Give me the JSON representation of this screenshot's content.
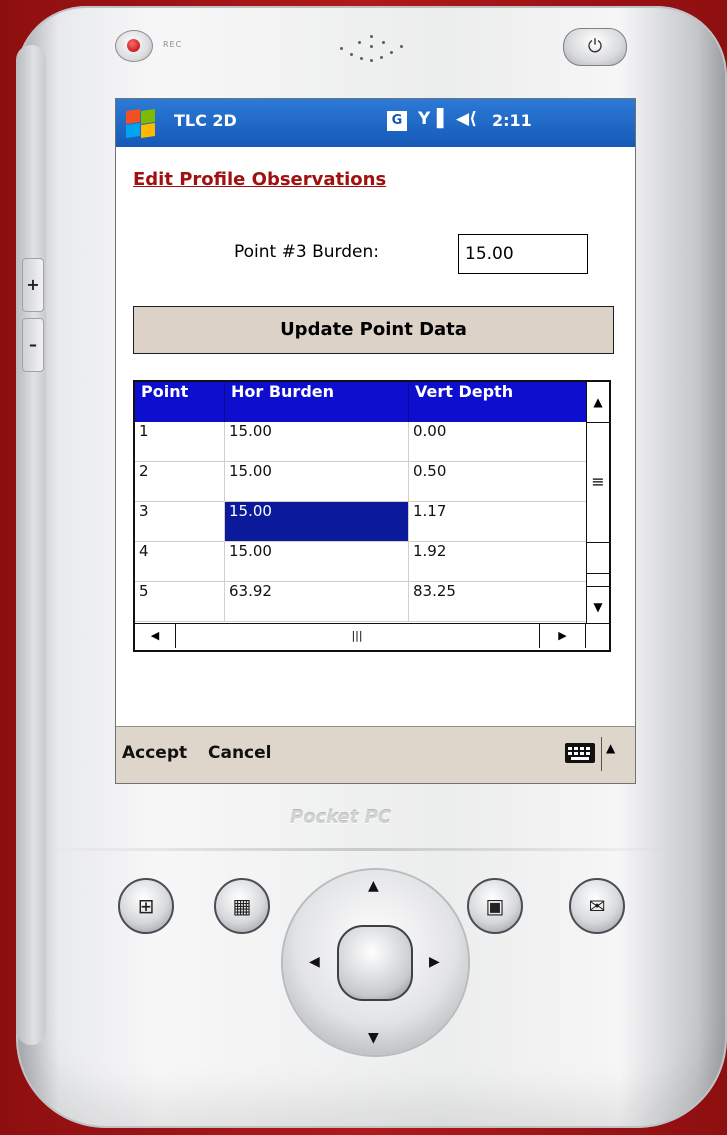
{
  "device": {
    "rec_label": "REC",
    "brand": "Pocket PC",
    "side_buttons": [
      "+",
      "–"
    ]
  },
  "status_bar": {
    "app_title": "TLC 2D",
    "g_badge": "G",
    "time": "2:11",
    "icons": [
      "windows-flag-icon",
      "signal-icon",
      "speaker-icon"
    ]
  },
  "form": {
    "heading": "Edit Profile Observations",
    "burden_label": "Point #3 Burden:",
    "burden_value": "15.00",
    "update_button": "Update Point Data"
  },
  "table": {
    "columns": [
      "Point",
      "Hor Burden",
      "Vert Depth"
    ],
    "rows": [
      [
        "1",
        "15.00",
        "0.00"
      ],
      [
        "2",
        "15.00",
        "0.50"
      ],
      [
        "3",
        "15.00",
        "1.17"
      ],
      [
        "4",
        "15.00",
        "1.92"
      ],
      [
        "5",
        "63.92",
        "83.25"
      ]
    ],
    "selected": {
      "row": 2,
      "col": 1
    }
  },
  "menu": {
    "accept": "Accept",
    "cancel": "Cancel"
  },
  "colors": {
    "titlebar": "#1559b8",
    "grid_header": "#0e0ecf",
    "selection": "#0a1a9a",
    "heading": "#a01010",
    "button_face": "#dcd2c8"
  }
}
